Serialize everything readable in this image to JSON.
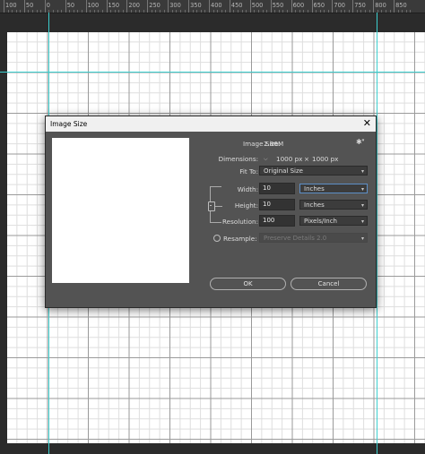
{
  "ruler": {
    "labels": [
      "100",
      "50",
      "0",
      "50",
      "100",
      "150",
      "200",
      "250",
      "300",
      "350",
      "400",
      "450",
      "500",
      "550",
      "600",
      "650",
      "700",
      "750",
      "800",
      "850"
    ]
  },
  "colors": {
    "guide": "#3ccfcf",
    "dialog_bg": "#535353",
    "canvas": "#ffffff"
  },
  "dialog": {
    "title": "Image Size",
    "close_icon": "close-icon",
    "image_size_label": "Image Size:",
    "image_size_value": "2.86M",
    "settings_icon": "gear-icon",
    "dimensions_label": "Dimensions:",
    "dimensions_width": "1000 px",
    "dimensions_times": "×",
    "dimensions_height": "1000 px",
    "fit_to_label": "Fit To:",
    "fit_to_value": "Original Size",
    "width_label": "Width:",
    "width_value": "10",
    "width_unit": "Inches",
    "height_label": "Height:",
    "height_value": "10",
    "height_unit": "Inches",
    "resolution_label": "Resolution:",
    "resolution_value": "100",
    "resolution_unit": "Pixels/Inch",
    "resample_label": "Resample:",
    "resample_value": "Preserve Details 2.0",
    "resample_checked": false,
    "ok_label": "OK",
    "cancel_label": "Cancel"
  }
}
